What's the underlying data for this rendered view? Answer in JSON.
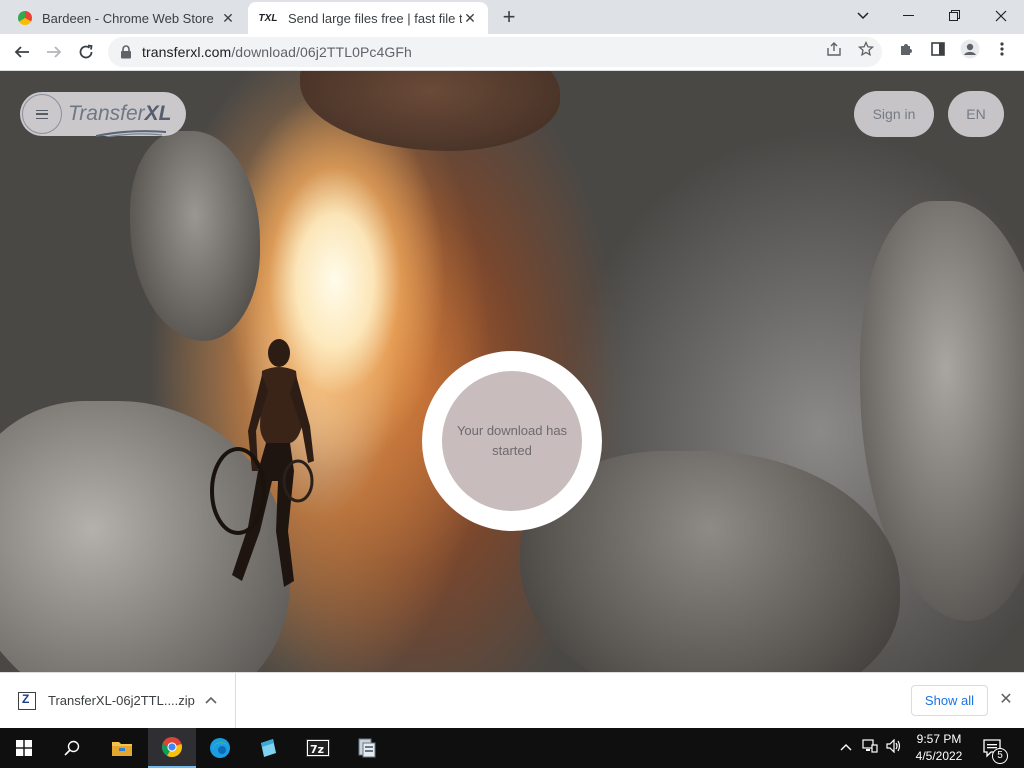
{
  "browser": {
    "tabs": [
      {
        "title": "Bardeen - Chrome Web Store",
        "favicon": "bardeen-icon",
        "active": false
      },
      {
        "title": "Send large files free | fast file tra",
        "favicon": "txl-icon",
        "favicon_text": "TXL",
        "active": true
      }
    ],
    "new_tab_label": "+",
    "url_domain": "transferxl.com",
    "url_path": "/download/06j2TTL0Pc4GFh"
  },
  "page": {
    "logo_text": "Transfer",
    "logo_text_bold": "XL",
    "signin_label": "Sign in",
    "language_label": "EN",
    "status_message": "Your download has started"
  },
  "download_shelf": {
    "filename": "TransferXL-06j2TTL....zip",
    "show_all_label": "Show all"
  },
  "taskbar": {
    "time": "9:57 PM",
    "date": "4/5/2022",
    "notification_count": "5",
    "apps": [
      "start-icon",
      "search-icon",
      "file-explorer-icon",
      "chrome-icon",
      "edge-icon",
      "notepad-icon",
      "7zip-icon",
      "installer-icon"
    ]
  },
  "colors": {
    "accent_blue": "#1a73e8",
    "tab_strip": "#dee1e6",
    "taskbar": "#0f0f10"
  }
}
